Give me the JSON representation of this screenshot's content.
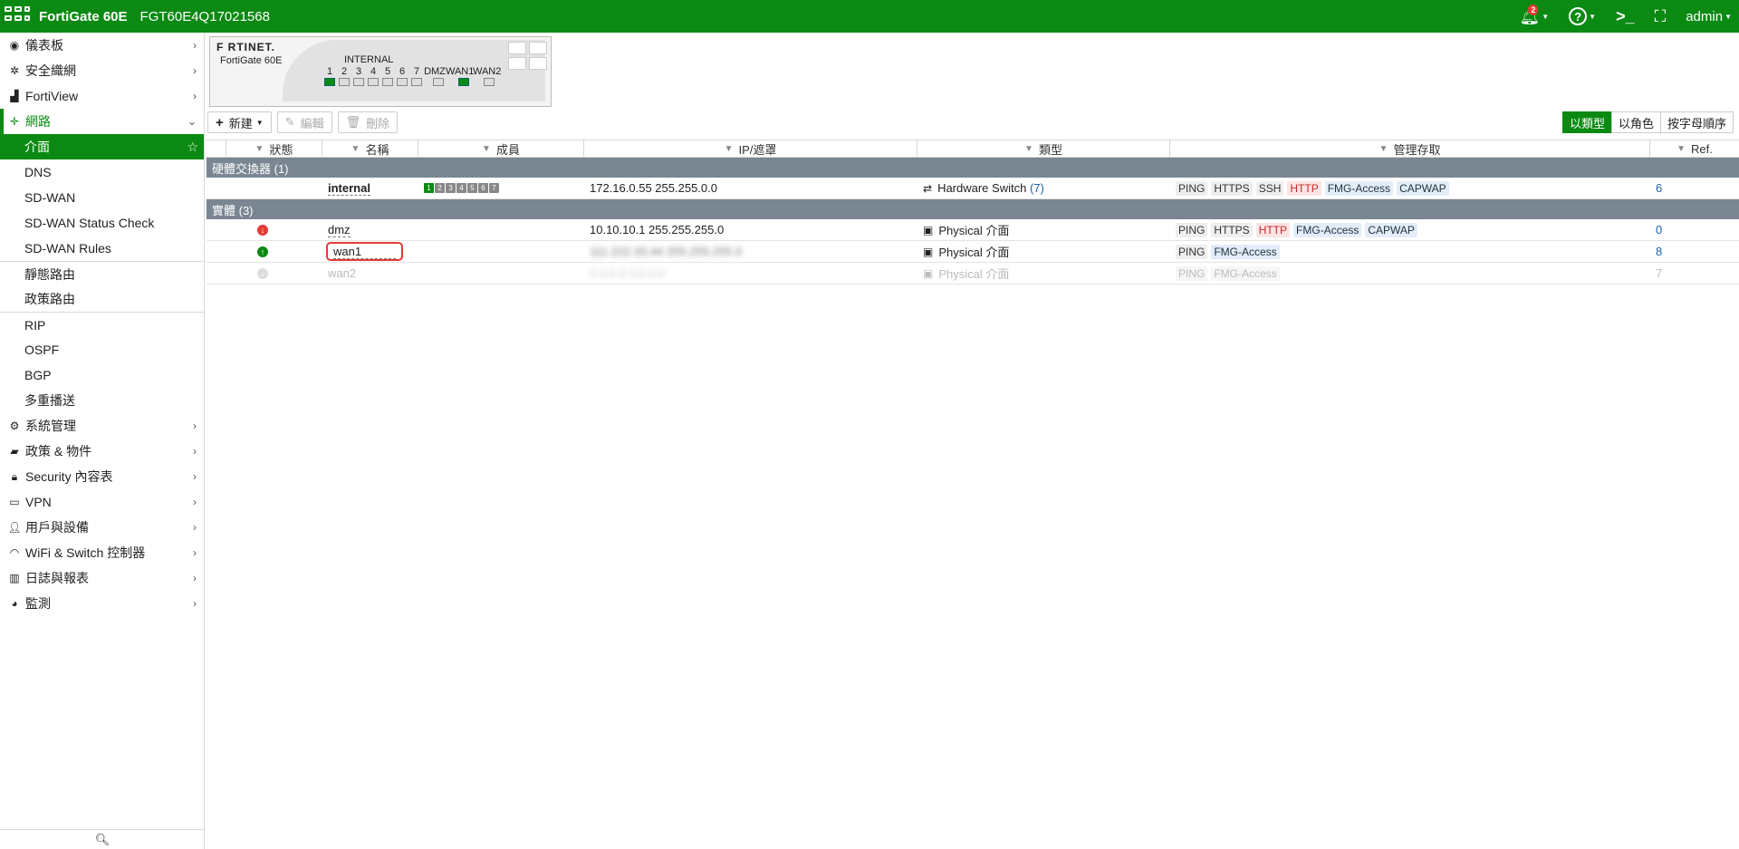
{
  "topbar": {
    "title": "FortiGate 60E",
    "serial": "FGT60E4Q17021568",
    "notify_count": "2",
    "user": "admin"
  },
  "sidebar": {
    "items": [
      {
        "label": "儀表板",
        "icon": "dashboard-icon"
      },
      {
        "label": "安全織網",
        "icon": "fabric-icon"
      },
      {
        "label": "FortiView",
        "icon": "chart-icon"
      },
      {
        "label": "網路",
        "icon": "network-icon"
      }
    ],
    "network_sub": [
      "介面",
      "DNS",
      "SD-WAN",
      "SD-WAN Status Check",
      "SD-WAN Rules",
      "靜態路由",
      "政策路由",
      "RIP",
      "OSPF",
      "BGP",
      "多重播送"
    ],
    "items_after": [
      {
        "label": "系統管理",
        "icon": "gear-icon"
      },
      {
        "label": "政策 & 物件",
        "icon": "policy-icon"
      },
      {
        "label": "Security 內容表",
        "icon": "lock-icon"
      },
      {
        "label": "VPN",
        "icon": "laptop-icon"
      },
      {
        "label": "用戶與設備",
        "icon": "user-icon"
      },
      {
        "label": "WiFi & Switch 控制器",
        "icon": "wifi-icon"
      },
      {
        "label": "日誌與報表",
        "icon": "log-icon"
      },
      {
        "label": "監測",
        "icon": "pie-icon"
      }
    ]
  },
  "device": {
    "brand": "F RTINET.",
    "model": "FortiGate 60E",
    "internal_label": "INTERNAL",
    "ports": [
      "1",
      "2",
      "3",
      "4",
      "5",
      "6",
      "7",
      "DMZ",
      "WAN1",
      "WAN2"
    ]
  },
  "toolbar": {
    "new_label": "新建",
    "edit_label": "編輯",
    "delete_label": "刪除",
    "views": [
      "以類型",
      "以角色",
      "按字母順序"
    ]
  },
  "table": {
    "headers": [
      "狀態",
      "名稱",
      "成員",
      "IP/遮罩",
      "類型",
      "管理存取",
      "Ref."
    ],
    "groups": [
      {
        "label": "硬體交換器 (1)",
        "rows": [
          {
            "name": "internal",
            "members": [
              "1",
              "2",
              "3",
              "4",
              "5",
              "6",
              "7"
            ],
            "ip": "172.16.0.55 255.255.0.0",
            "type": "Hardware Switch",
            "type_count": "(7)",
            "access": [
              "PING",
              "HTTPS",
              "SSH",
              "HTTP",
              "FMG-Access",
              "CAPWAP"
            ],
            "ref": "6"
          }
        ]
      },
      {
        "label": "實體 (3)",
        "rows": [
          {
            "name": "dmz",
            "ip": "10.10.10.1 255.255.255.0",
            "type": "Physical 介面",
            "access": [
              "PING",
              "HTTPS",
              "HTTP",
              "FMG-Access",
              "CAPWAP"
            ],
            "ref": "0"
          },
          {
            "name": "wan1",
            "ip": "111.222.33.44 255.255.255.0",
            "type": "Physical 介面",
            "access": [
              "PING",
              "FMG-Access"
            ],
            "ref": "8"
          },
          {
            "name": "wan2",
            "ip": "0.0.0.0 0.0.0.0",
            "type": "Physical 介面",
            "access": [
              "PING",
              "FMG-Access"
            ],
            "ref": "7"
          }
        ]
      }
    ]
  }
}
